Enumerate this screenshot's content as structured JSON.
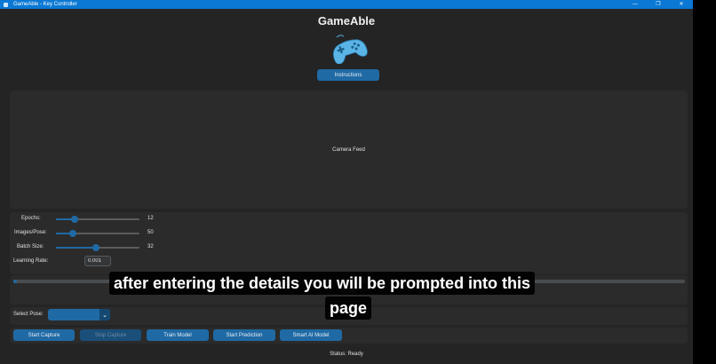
{
  "window": {
    "title": "GameAble - Key Controller",
    "controls": {
      "minimize": "—",
      "restore": "❐",
      "close": "✕"
    }
  },
  "header": {
    "app_name": "GameAble",
    "instructions_label": "Instructions"
  },
  "camera": {
    "placeholder": "Camera Feed"
  },
  "settings": {
    "epochs": {
      "label": "Epochs:",
      "value": "12",
      "fraction": 0.22
    },
    "images_per_pose": {
      "label": "Images/Pose:",
      "value": "50",
      "fraction": 0.2
    },
    "batch_size": {
      "label": "Batch Size:",
      "value": "32",
      "fraction": 0.48
    },
    "learning_rate": {
      "label": "Learning Rate:",
      "value": "0.001"
    }
  },
  "progress": {
    "value": 0.005,
    "status_text": "Ready"
  },
  "pose": {
    "label": "Select Pose:",
    "selected": ""
  },
  "actions": {
    "start_capture": "Start Capture",
    "stop_capture": "Stop Capture",
    "train_model": "Train Model",
    "start_prediction": "Start Prediction",
    "smart_ai_model": "Smart AI Model"
  },
  "status": "Status: Ready",
  "caption": {
    "line1": "after entering the details you will be prompted into this",
    "line2": "page"
  },
  "colors": {
    "accent": "#1f6aa5",
    "titlebar": "#0a78d4",
    "background": "#242424",
    "gamepad": "#5ab4e6"
  }
}
